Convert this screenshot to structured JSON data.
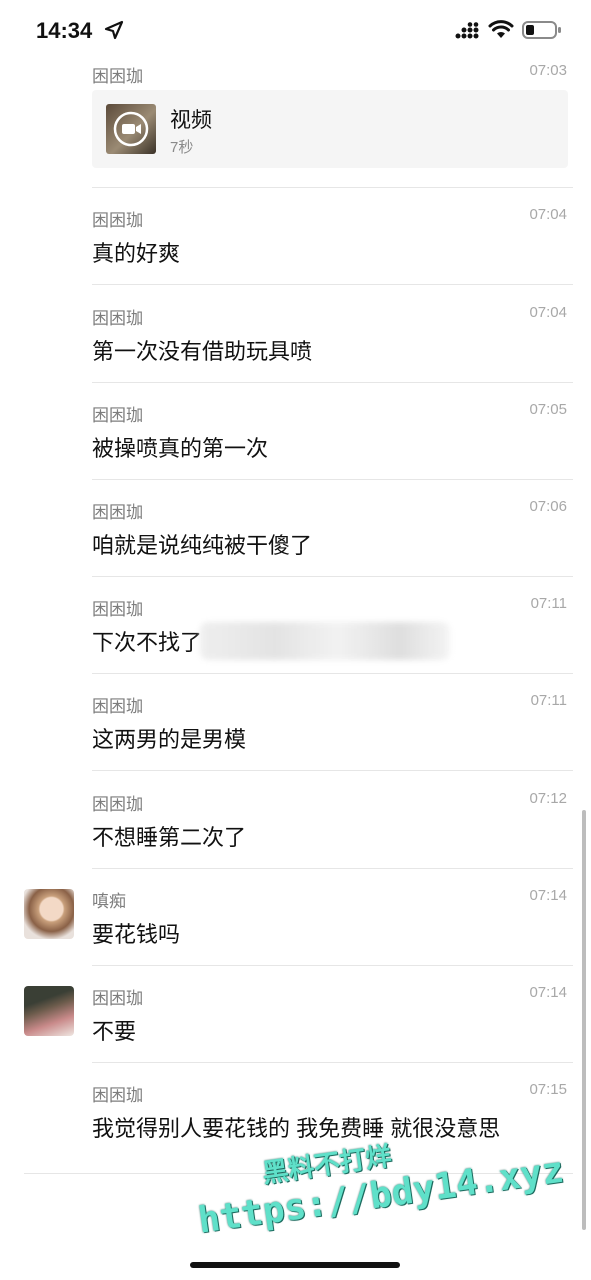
{
  "status_bar": {
    "time": "14:34"
  },
  "messages": [
    {
      "name": "困困珈",
      "time": "07:03",
      "card": {
        "title": "视频",
        "subtitle": "7秒"
      }
    },
    {
      "name": "困困珈",
      "time": "07:04",
      "text": "真的好爽"
    },
    {
      "name": "困困珈",
      "time": "07:04",
      "text": "第一次没有借助玩具喷"
    },
    {
      "name": "困困珈",
      "time": "07:05",
      "text": "被操喷真的第一次"
    },
    {
      "name": "困困珈",
      "time": "07:06",
      "text": "咱就是说纯纯被干傻了"
    },
    {
      "name": "困困珈",
      "time": "07:11",
      "text": "下次不找了"
    },
    {
      "name": "困困珈",
      "time": "07:11",
      "text": "这两男的是男模"
    },
    {
      "name": "困困珈",
      "time": "07:12",
      "text": "不想睡第二次了"
    },
    {
      "name": "嗔痴",
      "time": "07:14",
      "text": "要花钱吗"
    },
    {
      "name": "困困珈",
      "time": "07:14",
      "text": "不要"
    },
    {
      "name": "困困珈",
      "time": "07:15",
      "text": "我觉得别人要花钱的 我免费睡 就很没意思"
    }
  ],
  "watermark": {
    "line1": "黑料不打烊",
    "line2": "https://bdy14.xyz"
  }
}
